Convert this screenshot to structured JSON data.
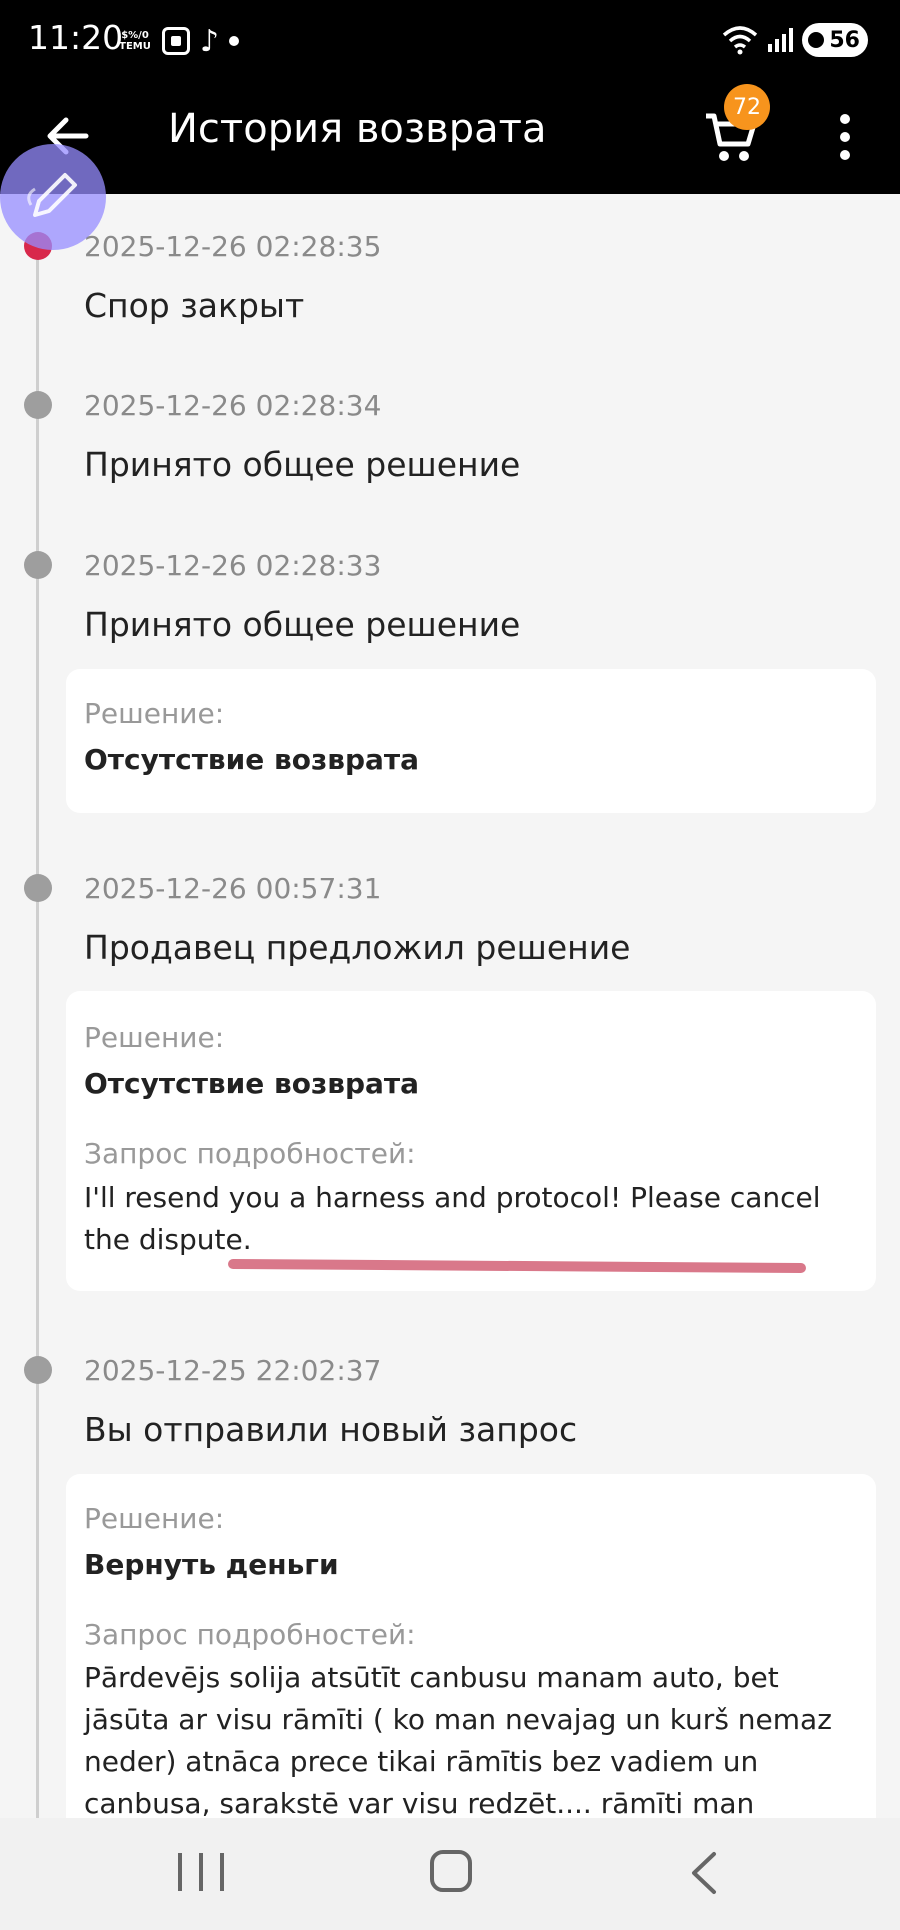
{
  "status_bar": {
    "time": "11:20",
    "notification_app_label": "$%/0\nTEMU",
    "battery_level": "56",
    "icons": [
      "temu-icon",
      "screen-capture-icon",
      "tiktok-icon",
      "notification-dot-icon",
      "wifi-icon",
      "signal-icon",
      "battery-icon"
    ]
  },
  "header": {
    "title": "История возврата",
    "cart_count": "72",
    "icons": [
      "back-arrow-icon",
      "cart-icon",
      "more-vert-icon"
    ]
  },
  "colors": {
    "header_bg": "#000000",
    "page_bg": "#f5f5f5",
    "active_dot": "#d8284b",
    "inactive_dot": "#9e9e9e",
    "cart_badge": "#f7941d",
    "edit_fab": "#968cff",
    "annotation_underline": "#d9788a"
  },
  "timeline": [
    {
      "timestamp": "2025-12-26 02:28:35",
      "title": "Спор закрыт",
      "active": true
    },
    {
      "timestamp": "2025-12-26 02:28:34",
      "title": "Принято общее решение"
    },
    {
      "timestamp": "2025-12-26 02:28:33",
      "title": "Принято общее решение",
      "card": {
        "decision_label": "Решение:",
        "decision_value": "Отсутствие возврата"
      }
    },
    {
      "timestamp": "2025-12-26 00:57:31",
      "title": "Продавец предложил решение",
      "card": {
        "decision_label": "Решение:",
        "decision_value": "Отсутствие возврата",
        "details_label": "Запрос подробностей:",
        "details_text": "I'll resend you a harness and protocol! Please cancel the dispute."
      }
    },
    {
      "timestamp": "2025-12-25 22:02:37",
      "title": "Вы отправили новый запрос",
      "card": {
        "decision_label": "Решение:",
        "decision_value": "Вернуть деньги",
        "details_label": "Запрос подробностей:",
        "details_text": "Pārdevējs solija atsūtīt canbusu manam auto, bet jāsūta ar visu rāmīti ( ko man nevajag un kurš nemaz neder) atnāca prece tikai rāmītis bez vadiem un canbusa, sarakstē var visu redzēt.... rāmīti man nevajag gribu vai nu savu canbus"
      }
    }
  ],
  "nav_bar": {
    "icons": [
      "recents-icon",
      "home-icon",
      "system-back-icon"
    ]
  }
}
